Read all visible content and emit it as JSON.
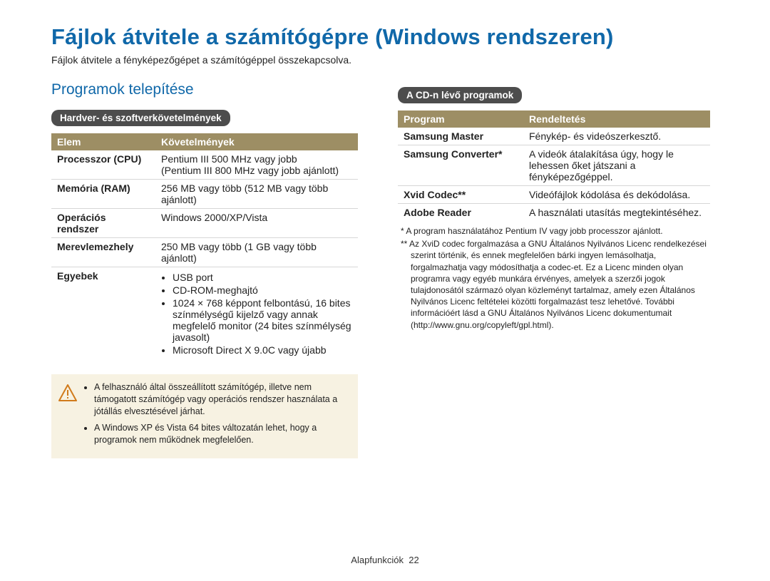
{
  "page_title": "Fájlok átvitele a számítógépre (Windows rendszeren)",
  "page_intro": "Fájlok átvitele a fényképezőgépet a számítógéppel összekapcsolva.",
  "section_title": "Programok telepítése",
  "left": {
    "pill": "Hardver- és szoftverkövetelmények",
    "table_headers": {
      "col1": "Elem",
      "col2": "Követelmények"
    },
    "rows": {
      "cpu_label": "Processzor (CPU)",
      "cpu_value_l1": "Pentium III 500 MHz vagy jobb",
      "cpu_value_l2": "(Pentium III 800 MHz vagy jobb ajánlott)",
      "ram_label": "Memória (RAM)",
      "ram_value": "256 MB vagy több (512 MB vagy több ajánlott)",
      "os_label": "Operációs rendszer",
      "os_value": "Windows 2000/XP/Vista",
      "hdd_label": "Merevlemezhely",
      "hdd_value": "250 MB vagy több (1 GB vagy több ajánlott)",
      "other_label": "Egyebek",
      "other_b1": "USB port",
      "other_b2": "CD-ROM-meghajtó",
      "other_b3": "1024 × 768 képpont felbontású, 16 bites színmélységű kijelző vagy annak megfelelő monitor (24 bites színmélység javasolt)",
      "other_b4": "Microsoft Direct X 9.0C vagy újabb"
    },
    "warn": {
      "b1": "A felhasználó által összeállított számítógép, illetve nem támogatott számítógép vagy operációs rendszer használata a jótállás elvesztésével járhat.",
      "b2": "A Windows XP és Vista 64 bites változatán lehet, hogy a programok nem működnek megfelelően."
    }
  },
  "right": {
    "pill": "A CD-n lévő programok",
    "table_headers": {
      "col1": "Program",
      "col2": "Rendeltetés"
    },
    "rows": {
      "r1_label": "Samsung Master",
      "r1_value": "Fénykép- és videószerkesztő.",
      "r2_label": "Samsung Converter*",
      "r2_value": "A videók átalakítása úgy, hogy le lehessen őket játszani a fényképezőgéppel.",
      "r3_label": "Xvid Codec**",
      "r3_value": "Videófájlok kódolása és dekódolása.",
      "r4_label": "Adobe Reader",
      "r4_value": "A használati utasítás megtekintéséhez."
    },
    "footnotes": {
      "f1": "* A program használatához Pentium IV vagy jobb processzor ajánlott.",
      "f2": "** Az XviD codec forgalmazása a GNU Általános Nyilvános Licenc rendelkezései szerint történik, és ennek megfelelően bárki ingyen lemásolhatja, forgalmazhatja vagy módosíthatja a codec-et. Ez a Licenc minden olyan programra vagy egyéb munkára érvényes, amelyek a szerzői jogok tulajdonosától származó olyan közleményt tartalmaz, amely ezen Általános Nyilvános Licenc feltételei közötti forgalmazást tesz lehetővé. További információért lásd a GNU Általános Nyilvános Licenc dokumentumait (http://www.gnu.org/copyleft/gpl.html)."
    }
  },
  "footer": {
    "section": "Alapfunkciók",
    "page": "22"
  }
}
